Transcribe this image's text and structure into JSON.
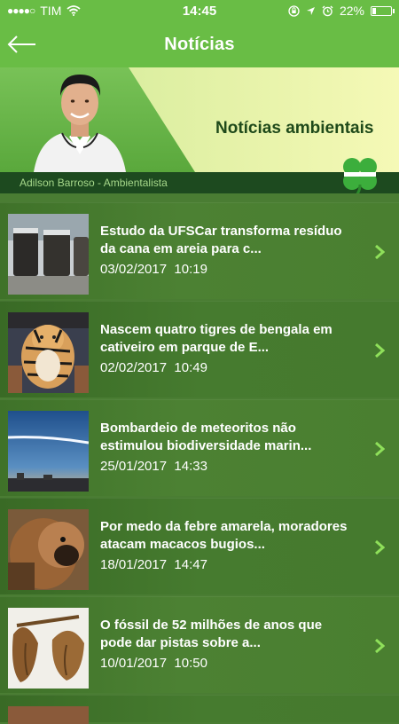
{
  "status_bar": {
    "carrier": "TIM",
    "time": "14:45",
    "battery_percent": "22%",
    "battery_level": 0.22
  },
  "nav": {
    "title": "Notícias",
    "back_icon": "back-arrow-icon"
  },
  "banner": {
    "title": "Notícias ambientais",
    "caption": "Adilson Barroso - Ambientalista",
    "logo_icon": "clover-logo-icon"
  },
  "colors": {
    "nav_green": "#69bd45",
    "banner_yellow": "#f3f7b0",
    "strip_green": "#1d4a1f",
    "list_green": "#4a7f30"
  },
  "news": [
    {
      "title": "Estudo da UFSCar transforma resíduo da cana em areia para c...",
      "date": "03/02/2017",
      "time": "10:19",
      "thumb_icon": "jars-photo-icon"
    },
    {
      "title": "Nascem quatro tigres de bengala em cativeiro em parque de E...",
      "date": "02/02/2017",
      "time": "10:49",
      "thumb_icon": "tiger-photo-icon"
    },
    {
      "title": "Bombardeio de meteoritos não estimulou biodiversidade marin...",
      "date": "25/01/2017",
      "time": "14:33",
      "thumb_icon": "meteor-sky-photo-icon"
    },
    {
      "title": "Por medo da febre amarela, moradores atacam macacos bugios...",
      "date": "18/01/2017",
      "time": "14:47",
      "thumb_icon": "monkey-photo-icon"
    },
    {
      "title": "O fóssil de 52 milhões de anos que pode dar pistas sobre a...",
      "date": "10/01/2017",
      "time": "10:50",
      "thumb_icon": "fossil-photo-icon"
    }
  ]
}
